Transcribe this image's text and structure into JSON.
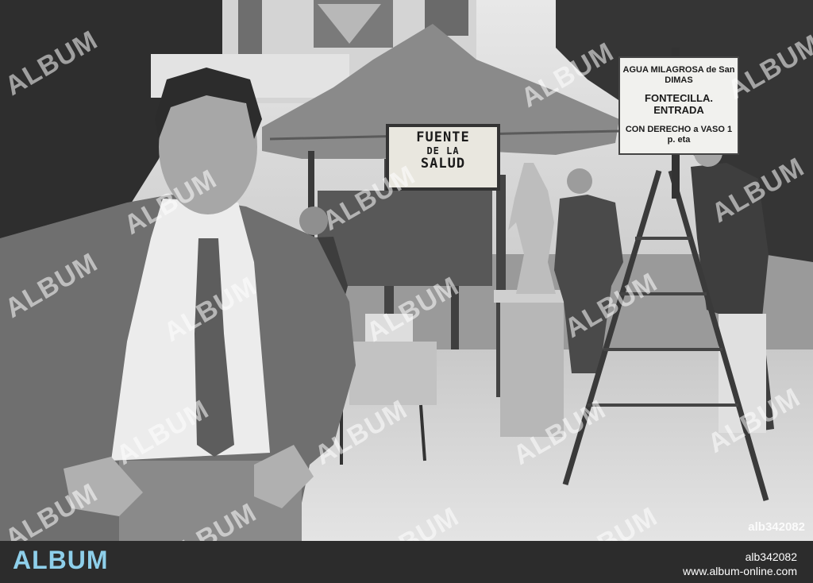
{
  "photo": {
    "sign_fuente": {
      "line1": "FUENTE",
      "line2": "DE LA",
      "line3": "SALUD"
    },
    "sign_agua": {
      "line1": "AGUA MILAGROSA de San DIMAS",
      "line2": "FONTECILLA. ENTRADA",
      "line3": "CON DERECHO a VASO 1 p. eta"
    },
    "watermark": "ALBUM",
    "photo_id": "alb342082"
  },
  "footer": {
    "logo": "ALBUM",
    "id": "alb342082",
    "url": "www.album-online.com"
  }
}
